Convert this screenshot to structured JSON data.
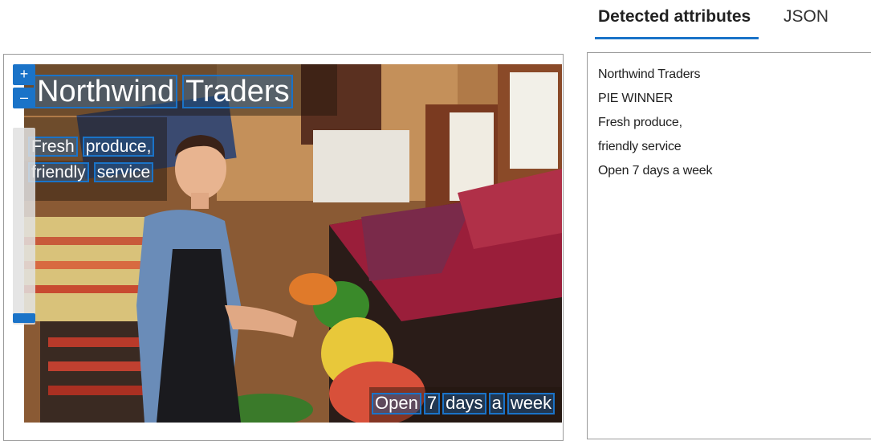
{
  "tabs": [
    {
      "label": "Detected attributes",
      "active": true
    },
    {
      "label": "JSON",
      "active": false
    }
  ],
  "zoom": {
    "in_label": "+",
    "out_label": "–",
    "level": 0.04
  },
  "image": {
    "ocr_lines": [
      {
        "words": [
          "Northwind",
          "Traders"
        ]
      },
      {
        "words": [
          "Fresh",
          "produce,"
        ]
      },
      {
        "words": [
          "friendly",
          "service"
        ]
      },
      {
        "words": [
          "Open",
          "7",
          "days",
          "a",
          "week"
        ]
      }
    ]
  },
  "results": {
    "items": [
      "Northwind Traders",
      "PIE WINNER",
      "Fresh produce,",
      "friendly service",
      "Open 7 days a week"
    ]
  },
  "colors": {
    "accent": "#1a73c8",
    "border": "#9a9a9a"
  }
}
